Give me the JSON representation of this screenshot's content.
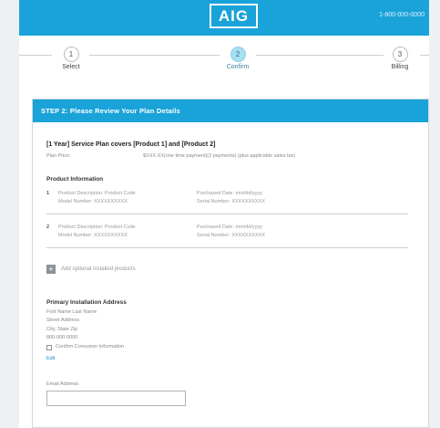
{
  "header": {
    "logo": "AIG",
    "phone": "1-800-000-0000",
    "brand_color": "#1aa3d8"
  },
  "stepper": {
    "steps": [
      {
        "number": "1",
        "label": "Select",
        "active": false
      },
      {
        "number": "2",
        "label": "Confirm",
        "active": true
      },
      {
        "number": "3",
        "label": "Billing",
        "active": false
      }
    ]
  },
  "review": {
    "heading": "STEP 2: Please Review Your Plan Details",
    "plan_title": "[1 Year] Service Plan covers [Product 1] and [Product 2]",
    "plan_price_label": "Plan Price:",
    "plan_price_value": "$XXX.XX(one time payment)(3 payments) (plus applicable sales tax)",
    "product_info_title": "Product Information",
    "products": [
      {
        "number": "1",
        "description": "Product Description: Product Code",
        "model": "Model Number: XXXXXXXXXX",
        "purchased": "Purchased Date: mm/dd/yyyy",
        "serial": "Serial Number: XXXXXXXXXX"
      },
      {
        "number": "2",
        "description": "Product Description: Product Code",
        "model": "Model Number: XXXXXXXXXX",
        "purchased": "Purchased Date: mm/dd/yyyy",
        "serial": "Serial Number: XXXXXXXXXX"
      }
    ],
    "add_products_label": "Add optional installed products",
    "add_icon": "+",
    "address_title": "Primary Installation Address",
    "address_lines": [
      "First Name Last Name",
      "Street Address",
      "City, State Zip",
      "800-000-0000"
    ],
    "confirm_label": "Confirm Consumer Information",
    "edit_label": "Edit",
    "email_label": "Email Address",
    "email_value": ""
  }
}
